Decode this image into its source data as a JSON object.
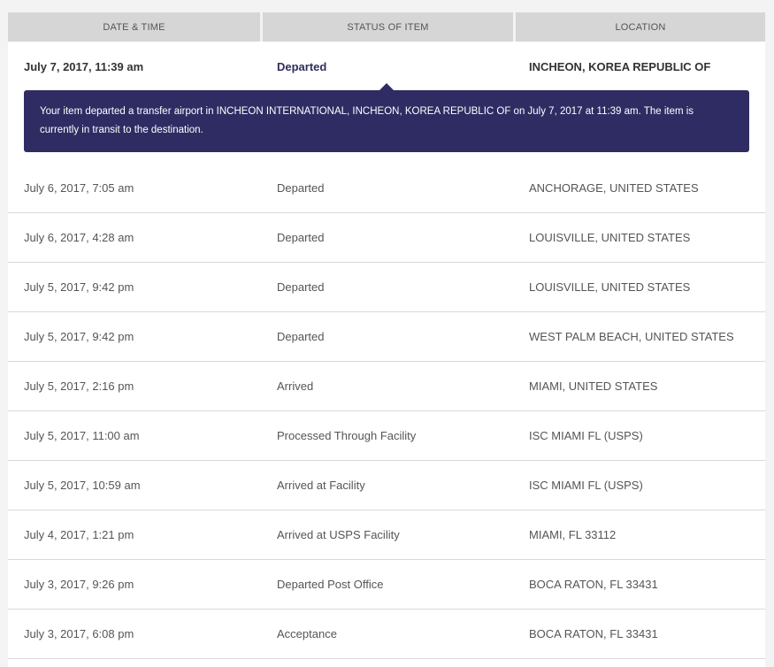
{
  "table": {
    "headers": {
      "date_time": "DATE & TIME",
      "status": "STATUS OF ITEM",
      "location": "LOCATION"
    },
    "active": {
      "date": "July 7, 2017, 11:39 am",
      "status": "Departed",
      "location": "INCHEON, KOREA REPUBLIC OF",
      "detail": "Your item departed a transfer airport in INCHEON INTERNATIONAL, INCHEON, KOREA REPUBLIC OF on July 7, 2017 at 11:39 am. The item is currently in transit to the destination."
    },
    "rows": [
      {
        "date": "July 6, 2017, 7:05 am",
        "status": "Departed",
        "location": "ANCHORAGE, UNITED STATES"
      },
      {
        "date": "July 6, 2017, 4:28 am",
        "status": "Departed",
        "location": "LOUISVILLE, UNITED STATES"
      },
      {
        "date": "July 5, 2017, 9:42 pm",
        "status": "Departed",
        "location": "LOUISVILLE, UNITED STATES"
      },
      {
        "date": "July 5, 2017, 9:42 pm",
        "status": "Departed",
        "location": "WEST PALM BEACH, UNITED STATES"
      },
      {
        "date": "July 5, 2017, 2:16 pm",
        "status": "Arrived",
        "location": "MIAMI, UNITED STATES"
      },
      {
        "date": "July 5, 2017, 11:00 am",
        "status": "Processed Through Facility",
        "location": "ISC MIAMI FL (USPS)"
      },
      {
        "date": "July 5, 2017, 10:59 am",
        "status": "Arrived at Facility",
        "location": "ISC MIAMI FL (USPS)"
      },
      {
        "date": "July 4, 2017, 1:21 pm",
        "status": "Arrived at USPS Facility",
        "location": "MIAMI, FL 33112"
      },
      {
        "date": "July 3, 2017, 9:26 pm",
        "status": "Departed Post Office",
        "location": "BOCA RATON, FL 33431"
      },
      {
        "date": "July 3, 2017, 6:08 pm",
        "status": "Acceptance",
        "location": "BOCA RATON, FL 33431"
      }
    ]
  }
}
